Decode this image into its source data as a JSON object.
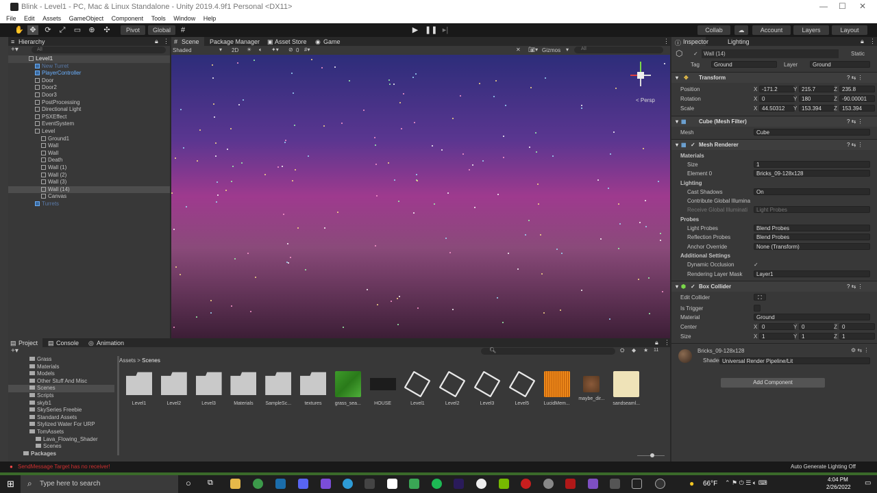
{
  "window": {
    "title": "Blink - Level1 - PC, Mac & Linux Standalone - Unity 2019.4.9f1 Personal <DX11>"
  },
  "menu": [
    "File",
    "Edit",
    "Assets",
    "GameObject",
    "Component",
    "Tools",
    "Window",
    "Help"
  ],
  "toolbar": {
    "pivot": "Pivot",
    "global": "Global",
    "collab": "Collab",
    "account": "Account",
    "layers": "Layers",
    "layout": "Layout"
  },
  "hierarchy": {
    "tab": "Hierarchy",
    "search_placeholder": "All",
    "items": [
      {
        "label": "Level1",
        "indent": 0
      },
      {
        "label": "New Turret",
        "indent": 1
      },
      {
        "label": "PlayerController",
        "indent": 1
      },
      {
        "label": "Door",
        "indent": 1
      },
      {
        "label": "Door2",
        "indent": 1
      },
      {
        "label": "Door3",
        "indent": 1
      },
      {
        "label": "PostProcessing",
        "indent": 1
      },
      {
        "label": "Directional Light",
        "indent": 1
      },
      {
        "label": "PSXEffect",
        "indent": 1
      },
      {
        "label": "EventSystem",
        "indent": 1
      },
      {
        "label": "Level",
        "indent": 1
      },
      {
        "label": "Ground1",
        "indent": 2
      },
      {
        "label": "Wall",
        "indent": 2
      },
      {
        "label": "Wall",
        "indent": 2
      },
      {
        "label": "Death",
        "indent": 2
      },
      {
        "label": "Wall (1)",
        "indent": 2
      },
      {
        "label": "Wall (2)",
        "indent": 2
      },
      {
        "label": "Wall (3)",
        "indent": 2
      },
      {
        "label": "Wall (14)",
        "indent": 2
      },
      {
        "label": "Canvas",
        "indent": 2
      },
      {
        "label": "Turrets",
        "indent": 1
      }
    ]
  },
  "scene": {
    "tabs": [
      "Scene",
      "Package Manager",
      "Asset Store",
      "Game"
    ],
    "shading": "Shaded",
    "mode2d": "2D",
    "gizmos": "Gizmos",
    "search_placeholder": "All",
    "persp": "< Persp",
    "hidden_count": "0"
  },
  "inspector": {
    "tabs": [
      "Inspector",
      "Lighting"
    ],
    "object_name": "Wall (14)",
    "static": "Static",
    "tag_label": "Tag",
    "tag_value": "Ground",
    "layer_label": "Layer",
    "layer_value": "Ground",
    "transform": {
      "title": "Transform",
      "position": {
        "label": "Position",
        "x": "-171.2",
        "y": "215.7",
        "z": "235.8"
      },
      "rotation": {
        "label": "Rotation",
        "x": "0",
        "y": "180",
        "z": "-90.00001"
      },
      "scale": {
        "label": "Scale",
        "x": "44.50312",
        "y": "153.394",
        "z": "153.394"
      }
    },
    "mesh_filter": {
      "title": "Cube (Mesh Filter)",
      "mesh_label": "Mesh",
      "mesh_value": "Cube"
    },
    "mesh_renderer": {
      "title": "Mesh Renderer",
      "materials": "Materials",
      "size_label": "Size",
      "size_value": "1",
      "element0_label": "Element 0",
      "element0_value": "Bricks_09-128x128",
      "lighting": "Lighting",
      "cast_shadows_label": "Cast Shadows",
      "cast_shadows_value": "On",
      "contribute_gi": "Contribute Global Illumina",
      "receive_gi_label": "Receive Global Illuminati",
      "receive_gi_value": "Light Probes",
      "probes": "Probes",
      "light_probes_label": "Light Probes",
      "light_probes_value": "Blend Probes",
      "reflection_probes_label": "Reflection Probes",
      "reflection_probes_value": "Blend Probes",
      "anchor_override_label": "Anchor Override",
      "anchor_override_value": "None (Transform)",
      "additional": "Additional Settings",
      "dynamic_occlusion": "Dynamic Occlusion",
      "rendering_layer_label": "Rendering Layer Mask",
      "rendering_layer_value": "Layer1"
    },
    "box_collider": {
      "title": "Box Collider",
      "edit_collider": "Edit Collider",
      "is_trigger": "Is Trigger",
      "material_label": "Material",
      "material_value": "Ground",
      "center_label": "Center",
      "center": {
        "x": "0",
        "y": "0",
        "z": "0"
      },
      "size_label": "Size",
      "size": {
        "x": "1",
        "y": "1",
        "z": "1"
      }
    },
    "material": {
      "name": "Bricks_09-128x128",
      "shader_label": "Shader",
      "shader_value": "Universal Render Pipeline/Lit"
    },
    "add_component": "Add Component"
  },
  "project": {
    "tabs": [
      "Project",
      "Console",
      "Animation"
    ],
    "tree": [
      {
        "label": "Grass",
        "indent": 1
      },
      {
        "label": "Materials",
        "indent": 1
      },
      {
        "label": "Models",
        "indent": 1
      },
      {
        "label": "Other Stuff And Misc",
        "indent": 1
      },
      {
        "label": "Scenes",
        "indent": 1
      },
      {
        "label": "Scripts",
        "indent": 1
      },
      {
        "label": "skyb1",
        "indent": 1
      },
      {
        "label": "SkySeries Freebie",
        "indent": 1
      },
      {
        "label": "Standard Assets",
        "indent": 1
      },
      {
        "label": "Stylized Water For URP",
        "indent": 1
      },
      {
        "label": "TomAssets",
        "indent": 1
      },
      {
        "label": "Lava_Flowing_Shader",
        "indent": 2
      },
      {
        "label": "Scenes",
        "indent": 2
      },
      {
        "label": "Packages",
        "indent": 0
      }
    ],
    "breadcrumb": [
      "Assets",
      "Scenes"
    ],
    "count": "11",
    "assets": [
      {
        "label": "Level1",
        "kind": "folder"
      },
      {
        "label": "Level2",
        "kind": "folder"
      },
      {
        "label": "Level3",
        "kind": "folder"
      },
      {
        "label": "Materials",
        "kind": "folder"
      },
      {
        "label": "SampleSc...",
        "kind": "folder"
      },
      {
        "label": "textures",
        "kind": "folder"
      },
      {
        "label": "grass_sea...",
        "kind": "grass"
      },
      {
        "label": "HOUSE",
        "kind": "house"
      },
      {
        "label": "Level1",
        "kind": "unity"
      },
      {
        "label": "Level2",
        "kind": "unity"
      },
      {
        "label": "Level3",
        "kind": "unity"
      },
      {
        "label": "Level5",
        "kind": "unity"
      },
      {
        "label": "LucidMem...",
        "kind": "audio"
      },
      {
        "label": "maybe_dir...",
        "kind": "dirt"
      },
      {
        "label": "sandseaml...",
        "kind": "sand"
      }
    ]
  },
  "status": {
    "error": "SendMessage Target has no receiver!",
    "lighting": "Auto Generate Lighting Off"
  },
  "taskbar": {
    "search_placeholder": "Type here to search",
    "weather": "66°F",
    "time": "4:04 PM",
    "date": "2/26/2022"
  },
  "colors": {
    "accent": "#4a90e2",
    "selection": "#2c5d87",
    "error": "#ff4a4a"
  }
}
